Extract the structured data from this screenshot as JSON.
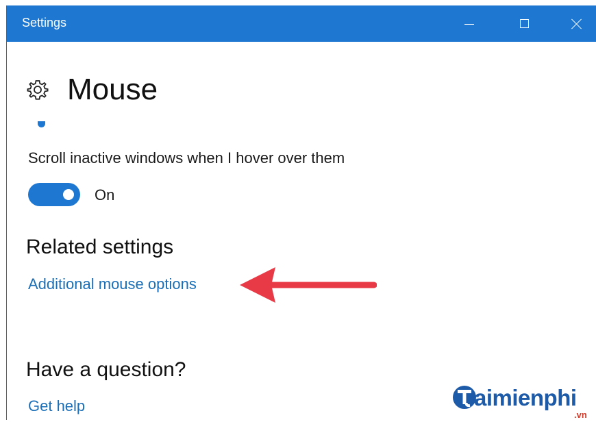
{
  "window": {
    "title": "Settings",
    "accent_color": "#1e78d2",
    "controls": {
      "minimize_icon": "minimize-icon",
      "maximize_icon": "maximize-icon",
      "close_icon": "close-icon"
    }
  },
  "page": {
    "icon": "gear-icon",
    "title": "Mouse"
  },
  "scroll_setting": {
    "label": "Scroll inactive windows when I hover over them",
    "toggle_on": true,
    "state_label": "On"
  },
  "related": {
    "heading": "Related settings",
    "link_label": "Additional mouse options",
    "link_color": "#1a6fb8",
    "annotation": {
      "icon": "red-arrow-icon",
      "color": "#e83a46"
    }
  },
  "help": {
    "heading": "Have a question?",
    "link_label": "Get help"
  },
  "watermark": {
    "brand": "aimienphi",
    "suffix": ".vn"
  }
}
